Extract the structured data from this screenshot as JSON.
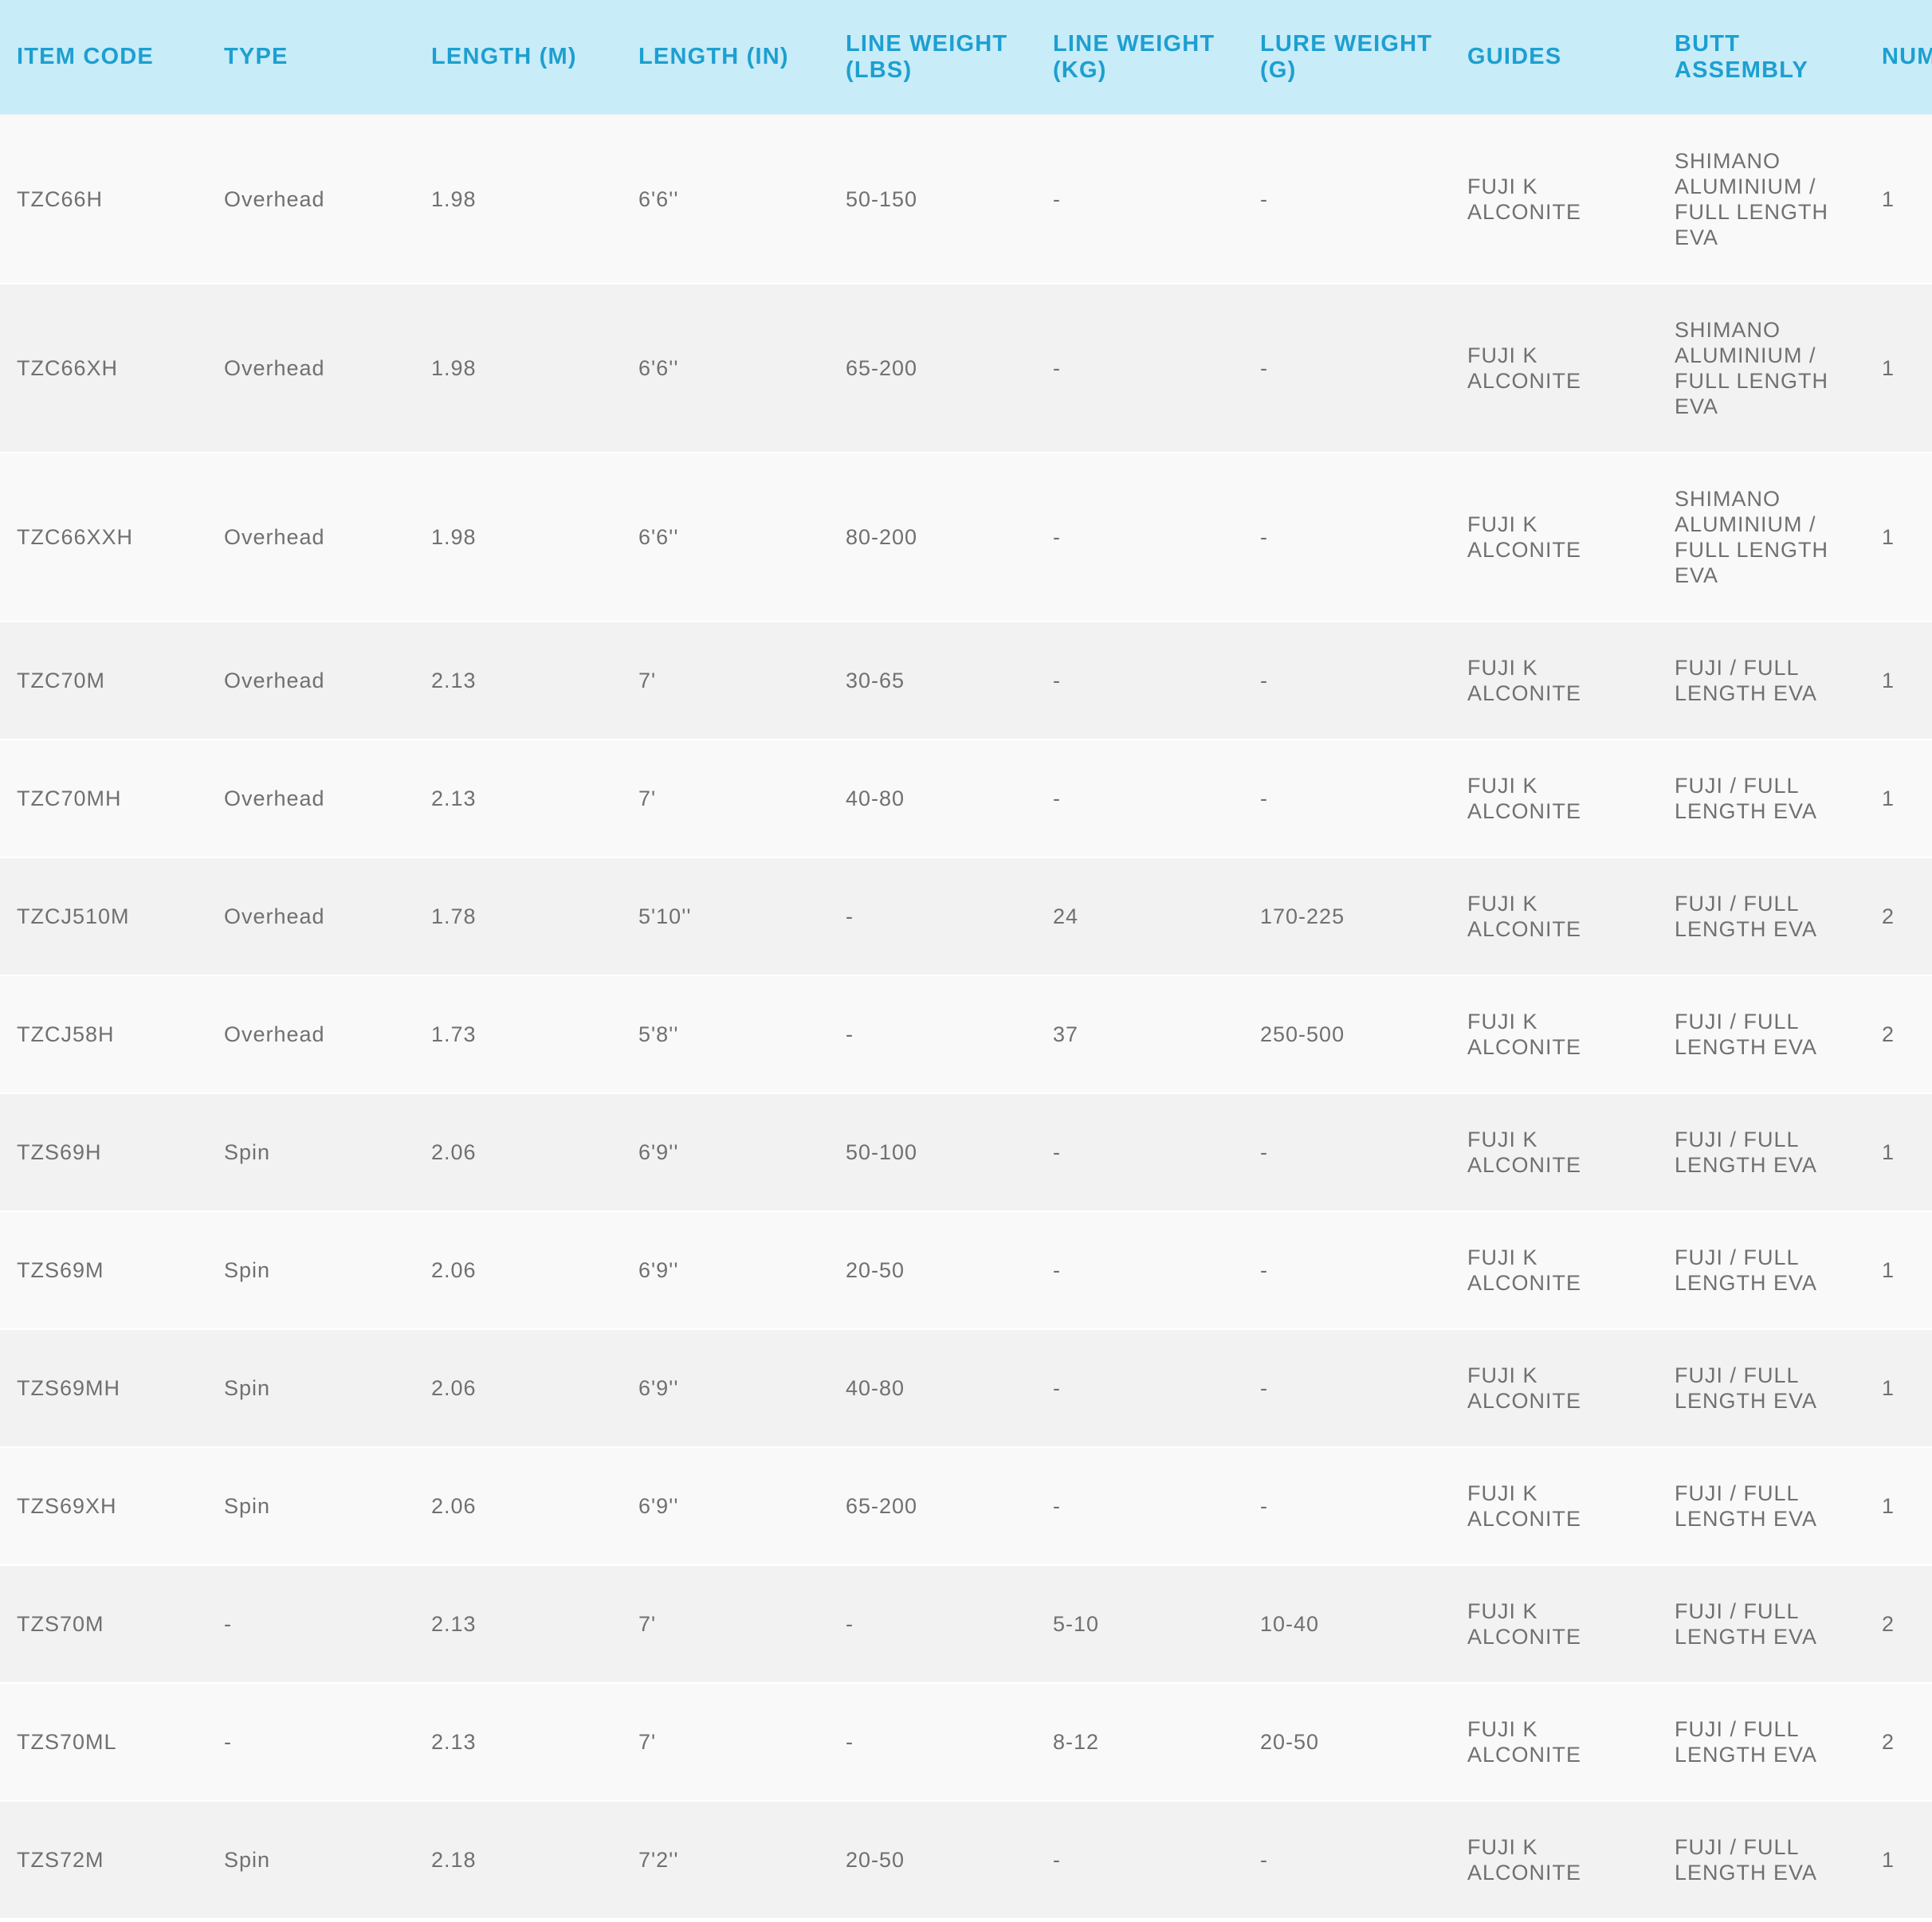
{
  "table": {
    "headers": [
      "ITEM CODE",
      "TYPE",
      "LENGTH (M)",
      "LENGTH (IN)",
      "LINE WEIGHT (LBS)",
      "LINE WEIGHT (KG)",
      "LURE WEIGHT (G)",
      "GUIDES",
      "BUTT ASSEMBLY",
      "NUM SEC"
    ],
    "rows": [
      [
        "TZC66H",
        "Overhead",
        "1.98",
        "6'6''",
        "50-150",
        "-",
        "-",
        "FUJI K ALCONITE",
        "SHIMANO ALUMINIUM / FULL LENGTH EVA",
        "1"
      ],
      [
        "TZC66XH",
        "Overhead",
        "1.98",
        "6'6''",
        "65-200",
        "-",
        "-",
        "FUJI K ALCONITE",
        "SHIMANO ALUMINIUM / FULL LENGTH EVA",
        "1"
      ],
      [
        "TZC66XXH",
        "Overhead",
        "1.98",
        "6'6''",
        "80-200",
        "-",
        "-",
        "FUJI K ALCONITE",
        "SHIMANO ALUMINIUM / FULL LENGTH EVA",
        "1"
      ],
      [
        "TZC70M",
        "Overhead",
        "2.13",
        "7'",
        "30-65",
        "-",
        "-",
        "FUJI K ALCONITE",
        "FUJI / FULL LENGTH EVA",
        "1"
      ],
      [
        "TZC70MH",
        "Overhead",
        "2.13",
        "7'",
        "40-80",
        "-",
        "-",
        "FUJI K ALCONITE",
        "FUJI / FULL LENGTH EVA",
        "1"
      ],
      [
        "TZCJ510M",
        "Overhead",
        "1.78",
        "5'10''",
        "-",
        "24",
        "170-225",
        "FUJI K ALCONITE",
        "FUJI / FULL LENGTH EVA",
        "2"
      ],
      [
        "TZCJ58H",
        "Overhead",
        "1.73",
        "5'8''",
        "-",
        "37",
        "250-500",
        "FUJI K ALCONITE",
        "FUJI / FULL LENGTH EVA",
        "2"
      ],
      [
        "TZS69H",
        "Spin",
        "2.06",
        "6'9''",
        "50-100",
        "-",
        "-",
        "FUJI K ALCONITE",
        "FUJI / FULL LENGTH EVA",
        "1"
      ],
      [
        "TZS69M",
        "Spin",
        "2.06",
        "6'9''",
        "20-50",
        "-",
        "-",
        "FUJI K ALCONITE",
        "FUJI / FULL LENGTH EVA",
        "1"
      ],
      [
        "TZS69MH",
        "Spin",
        "2.06",
        "6'9''",
        "40-80",
        "-",
        "-",
        "FUJI K ALCONITE",
        "FUJI / FULL LENGTH EVA",
        "1"
      ],
      [
        "TZS69XH",
        "Spin",
        "2.06",
        "6'9''",
        "65-200",
        "-",
        "-",
        "FUJI K ALCONITE",
        "FUJI / FULL LENGTH EVA",
        "1"
      ],
      [
        "TZS70M",
        "-",
        "2.13",
        "7'",
        "-",
        "5-10",
        "10-40",
        "FUJI K ALCONITE",
        "FUJI / FULL LENGTH EVA",
        "2"
      ],
      [
        "TZS70ML",
        "-",
        "2.13",
        "7'",
        "-",
        "8-12",
        "20-50",
        "FUJI K ALCONITE",
        "FUJI / FULL LENGTH EVA",
        "2"
      ],
      [
        "TZS72M",
        "Spin",
        "2.18",
        "7'2''",
        "20-50",
        "-",
        "-",
        "FUJI K ALCONITE",
        "FUJI / FULL LENGTH EVA",
        "1"
      ]
    ]
  }
}
